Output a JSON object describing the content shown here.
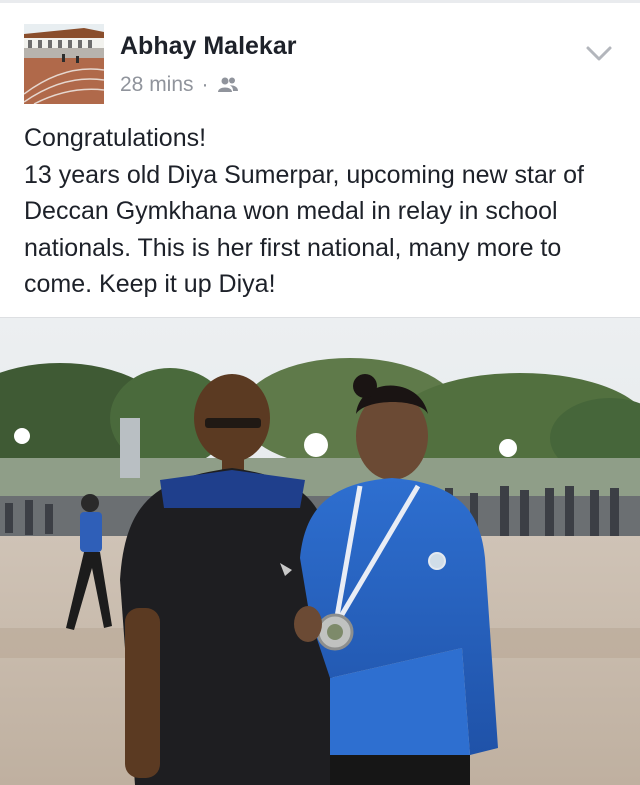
{
  "post": {
    "author": "Abhay Malekar",
    "time": "28 mins",
    "separator": "·",
    "audience_icon": "friends-icon",
    "menu_icon": "chevron-down-icon",
    "text": "Congratulations!\n13 years old Diya Sumerpar, upcoming new star of Deccan Gymkhana won medal in relay in school nationals. This is her first national, many more to come. Keep it up Diya!"
  },
  "photo": {
    "subject": "photo-coach-and-athlete-with-medal"
  }
}
